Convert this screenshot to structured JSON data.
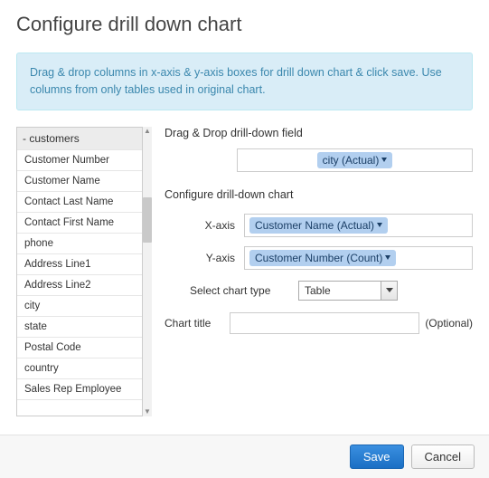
{
  "title": "Configure drill down chart",
  "info": "Drag & drop columns in x-axis & y-axis boxes for drill down chart & click save. Use columns from only tables used in original chart.",
  "tree": {
    "root": "customers",
    "items": [
      "Customer Number",
      "Customer Name",
      "Contact Last Name",
      "Contact First Name",
      "phone",
      "Address Line1",
      "Address Line2",
      "city",
      "state",
      "Postal Code",
      "country",
      "Sales Rep Employee"
    ]
  },
  "sections": {
    "dragdrop_label": "Drag & Drop drill-down field",
    "city_tag": "city (Actual)",
    "configure_label": "Configure drill-down chart",
    "xaxis_label": "X-axis",
    "xaxis_tag": "Customer Name (Actual)",
    "yaxis_label": "Y-axis",
    "yaxis_tag": "Customer Number (Count)",
    "charttype_label": "Select chart type",
    "charttype_value": "Table",
    "charttitle_label": "Chart title",
    "charttitle_value": "",
    "optional": "(Optional)"
  },
  "footer": {
    "save": "Save",
    "cancel": "Cancel"
  }
}
